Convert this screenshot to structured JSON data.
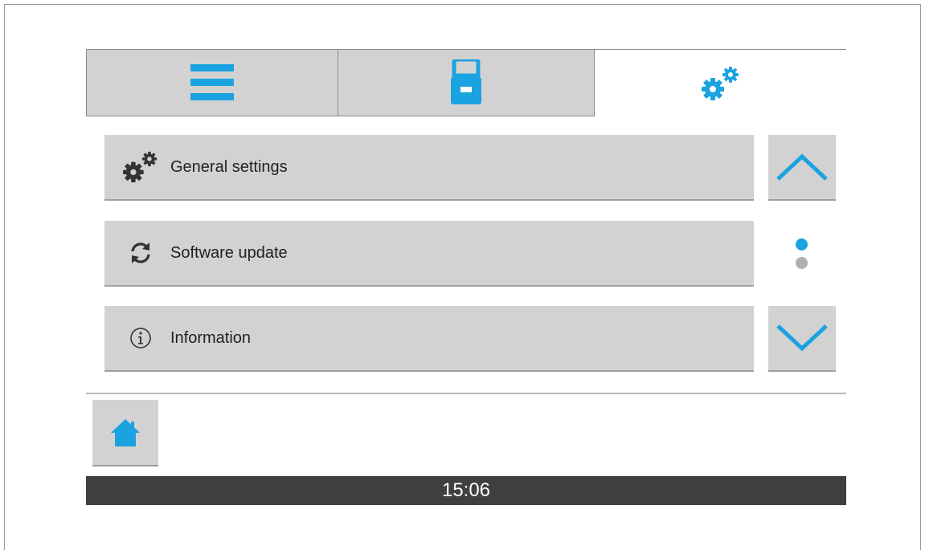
{
  "tabs": [
    {
      "icon": "menu-icon"
    },
    {
      "icon": "device-icon"
    },
    {
      "icon": "settings-gears-icon",
      "active": true
    }
  ],
  "menu": [
    {
      "label": "General settings",
      "icon": "settings-gears-icon"
    },
    {
      "label": "Software update",
      "icon": "refresh-icon"
    },
    {
      "label": "Information",
      "icon": "info-icon"
    }
  ],
  "pager": {
    "current_page": 1,
    "total_pages": 2
  },
  "status": {
    "time": "15:06"
  },
  "colors": {
    "accent": "#1aa3e0",
    "panel": "#d2d2d2",
    "status_bar": "#3f3f3f",
    "inactive_dot": "#b0b0b0",
    "icon_dark": "#333333"
  }
}
